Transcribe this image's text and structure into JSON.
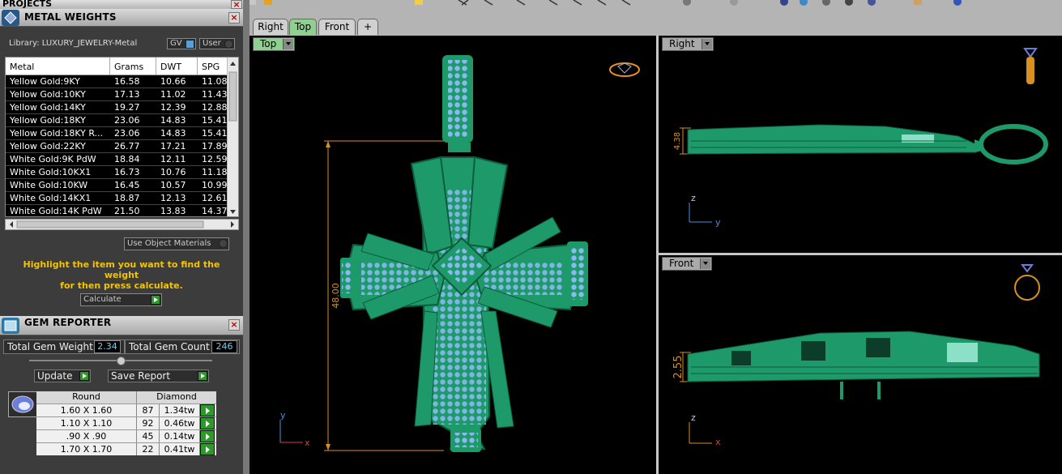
{
  "projects": {
    "title": "PROJECTS"
  },
  "metal_weights": {
    "title": "METAL WEIGHTS",
    "library_label": "Library: LUXURY_JEWELRY-Metal",
    "gv_label": "GV",
    "user_label": "User",
    "columns": [
      "Metal",
      "Grams",
      "DWT",
      "SPG"
    ],
    "rows": [
      [
        "Yellow Gold:9KY",
        "16.58",
        "10.66",
        "11.08"
      ],
      [
        "Yellow Gold:10KY",
        "17.13",
        "11.02",
        "11.43"
      ],
      [
        "Yellow Gold:14KY",
        "19.27",
        "12.39",
        "12.88"
      ],
      [
        "Yellow Gold:18KY",
        "23.06",
        "14.83",
        "15.41"
      ],
      [
        "Yellow Gold:18KY R...",
        "23.06",
        "14.83",
        "15.41"
      ],
      [
        "Yellow Gold:22KY",
        "26.77",
        "17.21",
        "17.89"
      ],
      [
        "White Gold:9K PdW",
        "18.84",
        "12.11",
        "12.59"
      ],
      [
        "White Gold:10KX1",
        "16.73",
        "10.76",
        "11.18"
      ],
      [
        "White Gold:10KW",
        "16.45",
        "10.57",
        "10.99"
      ],
      [
        "White Gold:14KX1",
        "18.87",
        "12.13",
        "12.61"
      ],
      [
        "White Gold:14K PdW",
        "21.50",
        "13.83",
        "14.37"
      ]
    ],
    "use_object_materials": "Use Object Materials",
    "hint_line1": "Highlight the item you want to find the weight",
    "hint_line2": "for then press calculate.",
    "calculate_label": "Calculate"
  },
  "gem_reporter": {
    "title": "GEM REPORTER",
    "total_weight_label": "Total Gem Weight",
    "total_weight_value": "2.34",
    "total_count_label": "Total Gem Count",
    "total_count_value": "246",
    "update_label": "Update",
    "save_report_label": "Save Report",
    "columns": [
      "Round",
      "Diamond"
    ],
    "rows": [
      [
        "1.60 X 1.60",
        "87",
        "1.34tw"
      ],
      [
        "1.10 X 1.10",
        "92",
        "0.46tw"
      ],
      [
        ".90 X .90",
        "45",
        "0.14tw"
      ],
      [
        "1.70 X 1.70",
        "22",
        "0.41tw"
      ]
    ]
  },
  "viewport_tabs": [
    "Right",
    "Top",
    "Front",
    "+"
  ],
  "viewports": {
    "top": {
      "label": "Top",
      "dimension": "48.00",
      "axis_x": "x",
      "axis_y": "y"
    },
    "right": {
      "label": "Right",
      "dimension": "4.38",
      "axis_a": "z",
      "axis_b": "y"
    },
    "front": {
      "label": "Front",
      "dimension": "2.55",
      "axis_a": "z",
      "axis_b": "x"
    }
  },
  "colors": {
    "model_green": "#1e9a6a",
    "gem_blue": "#8ab8f0",
    "dimension_orange": "#d89020",
    "hint_yellow": "#f5c400"
  }
}
